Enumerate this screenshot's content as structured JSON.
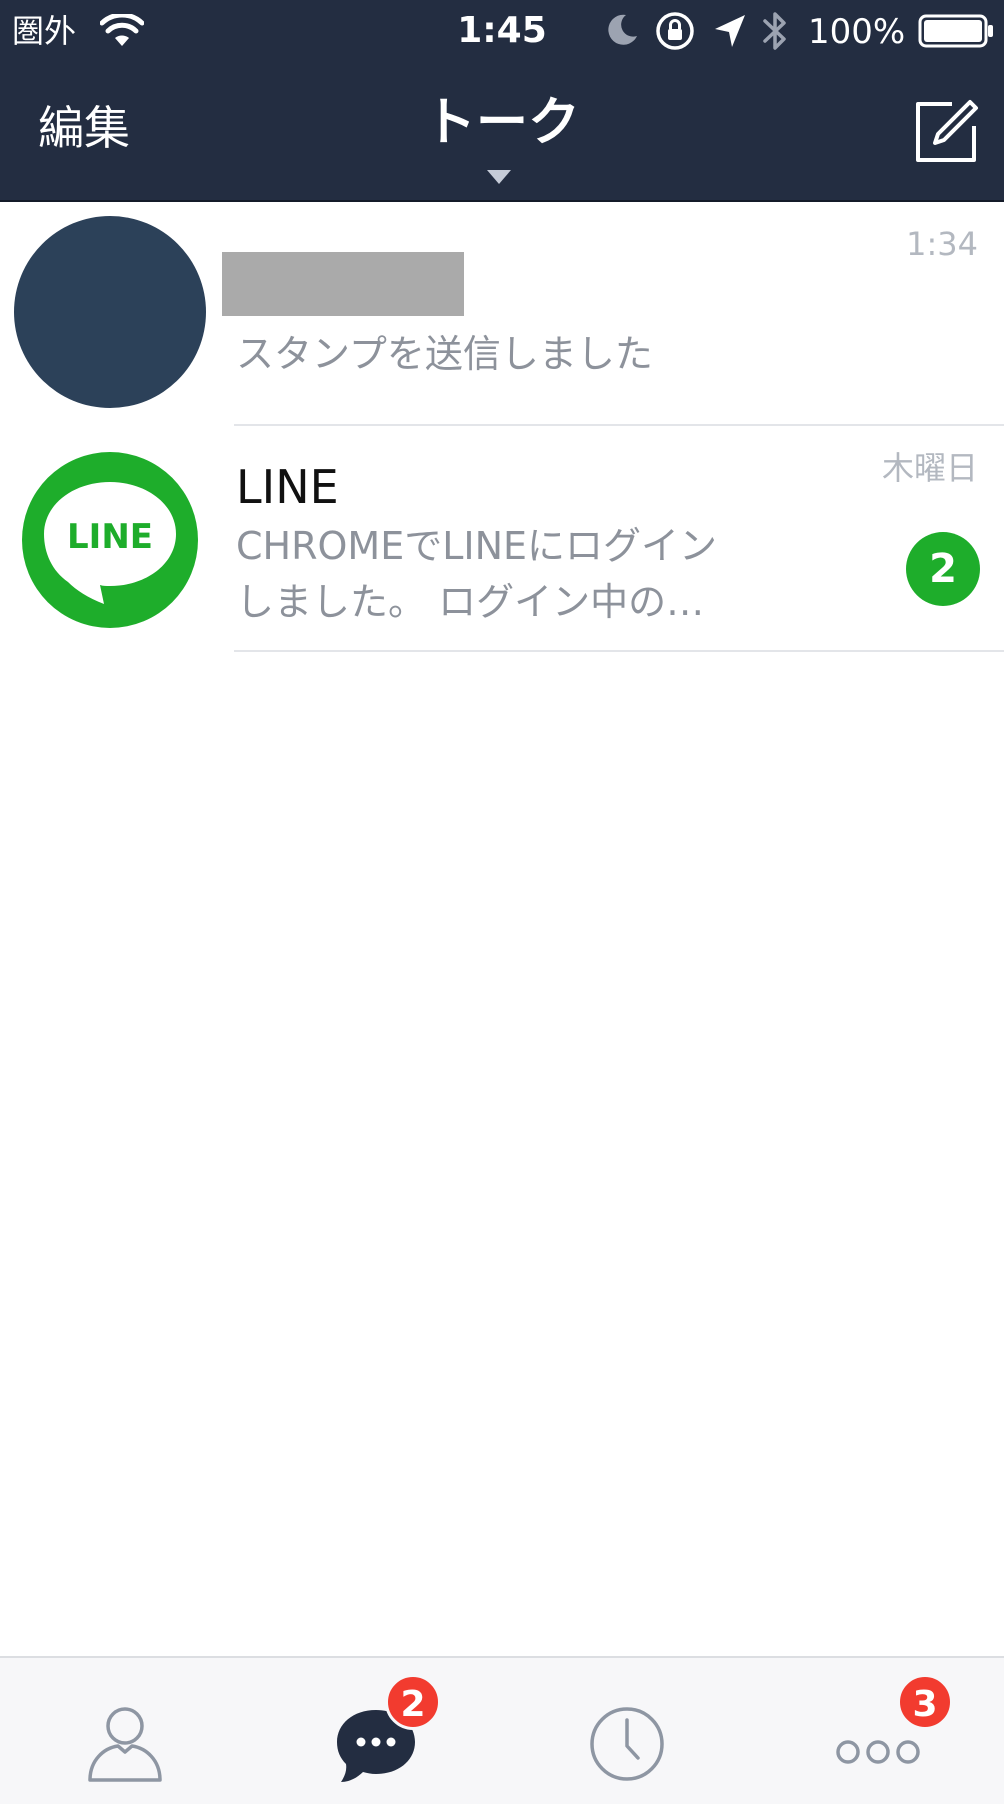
{
  "status_bar": {
    "carrier": "圏外",
    "time": "1:45",
    "battery_percent": "100%",
    "icons": [
      "wifi-icon",
      "moon-icon",
      "rotation-lock-icon",
      "location-arrow-icon",
      "bluetooth-icon",
      "battery-icon"
    ]
  },
  "nav": {
    "edit_label": "編集",
    "title": "トーク",
    "icons": [
      "chevron-down-icon",
      "compose-icon"
    ]
  },
  "chats": [
    {
      "name": "",
      "name_redacted": true,
      "time": "1:34",
      "preview": "スタンプを送信しました",
      "avatar": "dark-blue-circle"
    },
    {
      "name": "LINE",
      "time": "木曜日",
      "preview_line1": "CHROMEでLINEにログイン",
      "preview_line2": "しました。 ログイン中の…",
      "unread": "2",
      "avatar_logo_text": "LINE"
    }
  ],
  "tabs": [
    {
      "icon": "person-icon"
    },
    {
      "icon": "chat-bubble-icon",
      "badge": "2"
    },
    {
      "icon": "clock-icon"
    },
    {
      "icon": "more-dots-icon",
      "badge": "3"
    }
  ],
  "colors": {
    "header_bg": "#232d41",
    "line_green": "#1ead2b",
    "badge_red": "#f23b2f",
    "preview_gray": "#8d929b",
    "timestamp_gray": "#b3b8c0"
  }
}
